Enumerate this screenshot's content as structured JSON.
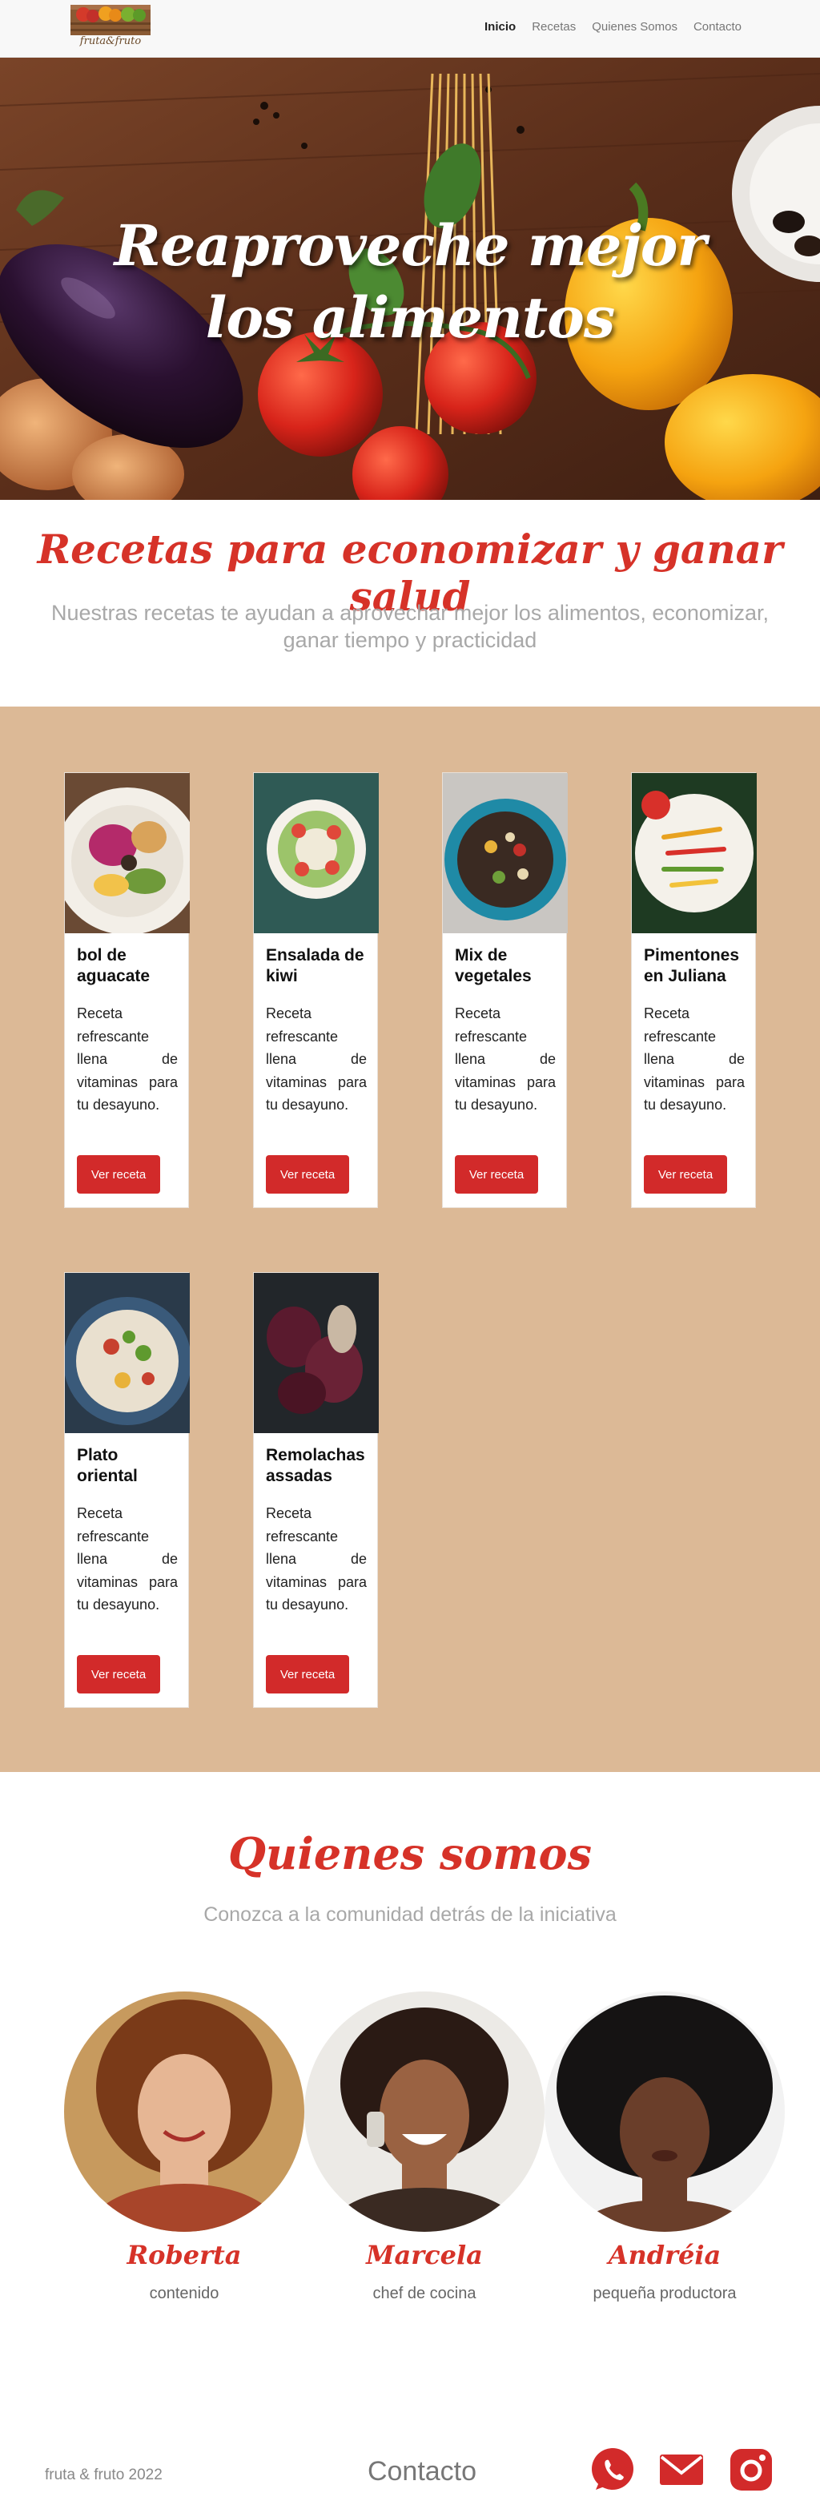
{
  "navbar": {
    "logo_text": "fruta&fruto",
    "links": [
      {
        "label": "Inicio",
        "active": true
      },
      {
        "label": "Recetas",
        "active": false
      },
      {
        "label": "Quienes Somos",
        "active": false
      },
      {
        "label": "Contacto",
        "active": false
      }
    ]
  },
  "hero": {
    "title": "Reaproveche mejor los alimentos"
  },
  "intro": {
    "title": "Recetas para economizar y ganar salud",
    "subtitle": "Nuestras recetas te ayudan a aprovechar mejor los alimentos, economizar, ganar tiempo y practicidad"
  },
  "recipes": [
    {
      "title": "bol de aguacate",
      "text": "Receta refrescante llena de vitaminas para tu desayuno.",
      "button": "Ver receta"
    },
    {
      "title": "Ensalada de kiwi",
      "text": "Receta refrescante llena de vitaminas para tu desayuno.",
      "button": "Ver receta"
    },
    {
      "title": "Mix de vegetales",
      "text": "Receta refrescante llena de vitaminas para tu desayuno.",
      "button": "Ver receta"
    },
    {
      "title": "Pimentones en Juliana",
      "text": "Receta refrescante llena de vitaminas para tu desayuno.",
      "button": "Ver receta"
    },
    {
      "title": "Plato oriental",
      "text": "Receta refrescante llena de vitaminas para tu desayuno.",
      "button": "Ver receta"
    },
    {
      "title": "Remolachas assadas",
      "text": "Receta refrescante llena de vitaminas para tu desayuno.",
      "button": "Ver receta"
    }
  ],
  "about": {
    "title": "Quienes somos",
    "subtitle": "Conozca a la comunidad detrás de la iniciativa",
    "members": [
      {
        "name": "Roberta",
        "role": "contenido"
      },
      {
        "name": "Marcela",
        "role": "chef de cocina"
      },
      {
        "name": "Andréia",
        "role": "pequeña productora"
      }
    ]
  },
  "footer": {
    "copyright": "fruta & fruto 2022",
    "contact": "Contacto",
    "social": [
      "whatsapp-icon",
      "email-icon",
      "instagram-icon"
    ]
  },
  "colors": {
    "accent": "#d63228",
    "button": "#d22a2a",
    "recipes_bg": "#dcb996",
    "muted_text": "#a8a8a8"
  }
}
